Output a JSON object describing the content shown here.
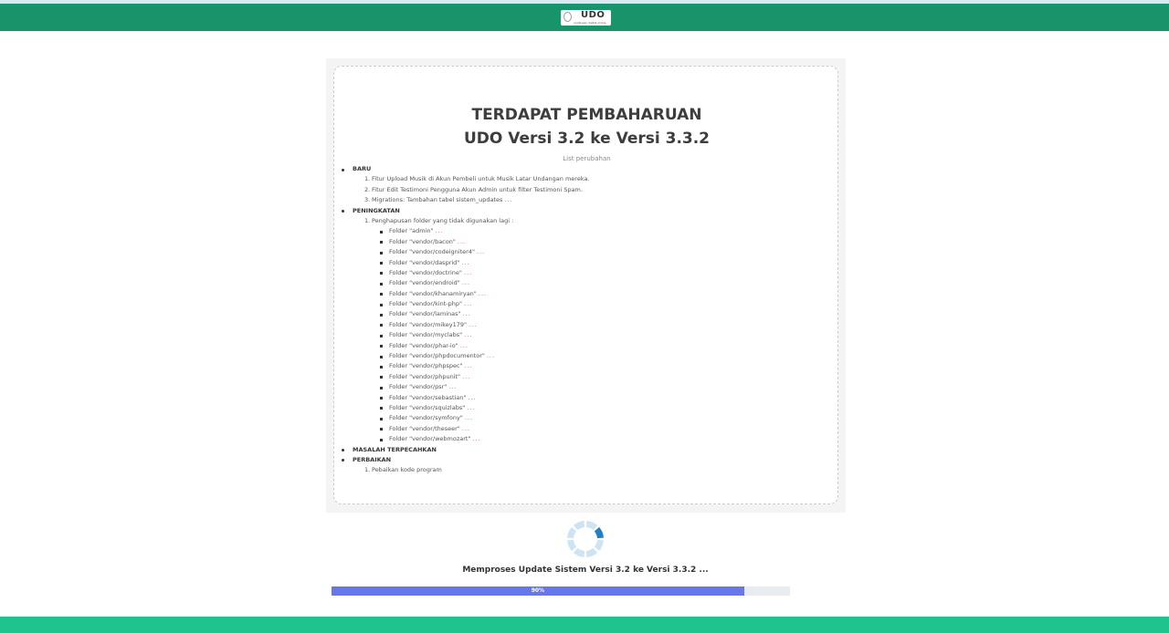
{
  "header": {
    "logo_text": "UDO",
    "logo_tagline": "undangan digital online",
    "colors": {
      "bar": "#18946b",
      "footer": "#1fc38d"
    }
  },
  "update": {
    "title_line1": "TERDAPAT PEMBAHARUAN",
    "title_line2": "UDO Versi 3.2 ke Versi 3.3.2",
    "subtitle": "List perubahan",
    "sections": {
      "baru": {
        "label": "BARU",
        "items": [
          "Fitur Upload Musik di Akun Pembeli untuk Musik Latar Undangan mereka.",
          "Fitur Edit Testimoni Pengguna Akun Admin untuk filter Testimoni Spam.",
          "Migrations: Tambahan tabel sistem_updates"
        ]
      },
      "peningkatan": {
        "label": "PENINGKATAN",
        "item": "Penghapusan folder yang tidak digunakan lagi :",
        "folders": [
          "Folder \"admin\"",
          "Folder \"vendor/bacon\"",
          "Folder \"vendor/codeigniter4\"",
          "Folder \"vendor/dasprid\"",
          "Folder \"vendor/doctrine\"",
          "Folder \"vendor/endroid\"",
          "Folder \"vendor/khanamiryan\"",
          "Folder \"vendor/kint-php\"",
          "Folder \"vendor/laminas\"",
          "Folder \"vendor/mikey179\"",
          "Folder \"vendor/myclabs\"",
          "Folder \"vendor/phar-io\"",
          "Folder \"vendor/phpdocumentor\"",
          "Folder \"vendor/phpspec\"",
          "Folder \"vendor/phpunit\"",
          "Folder \"vendor/psr\"",
          "Folder \"vendor/sebastian\"",
          "Folder \"vendor/squizlabs\"",
          "Folder \"vendor/symfony\"",
          "Folder \"vendor/theseer\"",
          "Folder \"vendor/webmozart\""
        ]
      },
      "masalah": {
        "label": "MASALAH TERPECAHKAN"
      },
      "perbaikan": {
        "label": "PERBAIKAN",
        "items": [
          "Pebaikan kode program"
        ]
      }
    },
    "ellipsis": "...",
    "numbers": [
      "1.",
      "2.",
      "3."
    ]
  },
  "progress": {
    "status_text": "Memproses Update Sistem Versi 3.2 ke Versi 3.3.2 ...",
    "percent_label": "90%",
    "value": 0.9,
    "color": "#6877e8"
  },
  "spinner": {
    "icon": "loading-spinner-icon",
    "color": "#1f7fc8"
  }
}
